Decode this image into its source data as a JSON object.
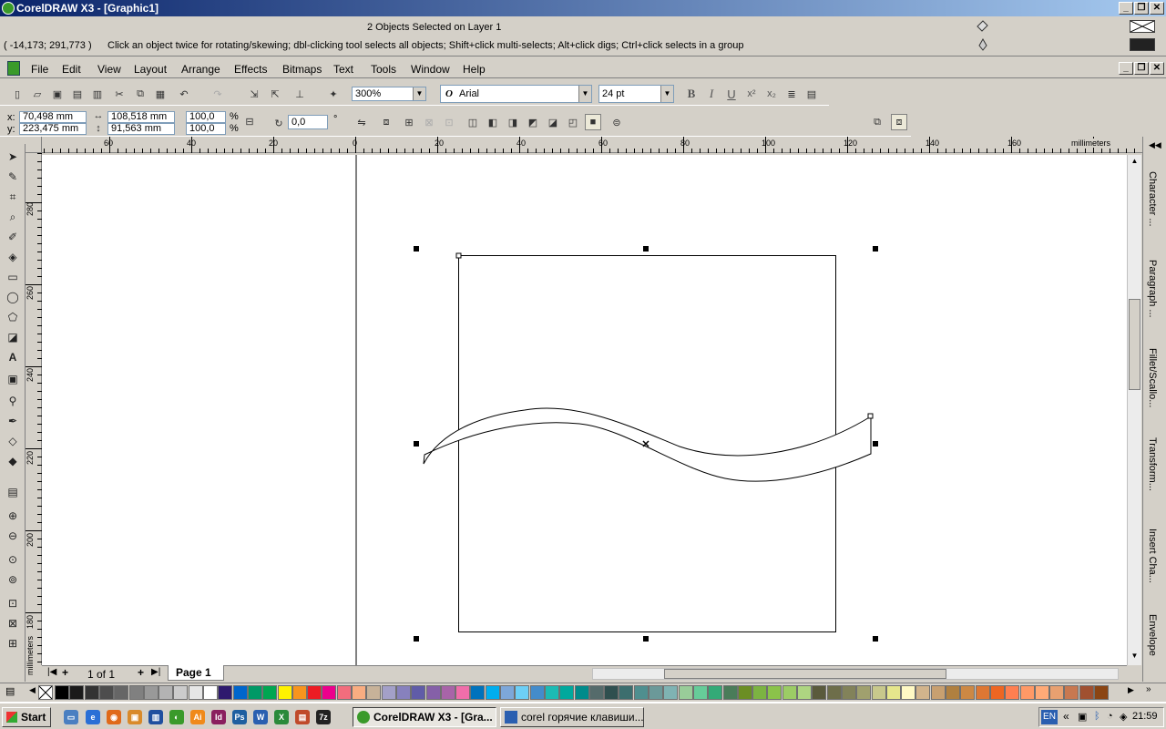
{
  "window": {
    "title": "CorelDRAW X3 - [Graphic1]"
  },
  "status": {
    "selection": "2 Objects Selected on Layer 1",
    "coords": "( -14,173; 291,773 )",
    "hint": "Click an object twice for rotating/skewing; dbl-clicking tool selects all objects; Shift+click multi-selects; Alt+click digs; Ctrl+click selects in a group"
  },
  "menu": [
    "File",
    "Edit",
    "View",
    "Layout",
    "Arrange",
    "Effects",
    "Bitmaps",
    "Text",
    "Tools",
    "Window",
    "Help"
  ],
  "toolbar": {
    "zoom": "300%",
    "font": "Arial",
    "font_size": "24 pt"
  },
  "property": {
    "x_label": "x:",
    "y_label": "y:",
    "x": "70,498 mm",
    "y": "223,475 mm",
    "width": "108,518 mm",
    "height": "91,563 mm",
    "scale_x": "100,0",
    "scale_y": "100,0",
    "pct": "%",
    "angle": "0,0",
    "deg": "°"
  },
  "hruler": {
    "unit": "millimeters",
    "ticks": [
      "60",
      "40",
      "20",
      "0",
      "20",
      "40",
      "60",
      "80",
      "100",
      "120",
      "140",
      "160"
    ]
  },
  "vruler": {
    "unit": "millimeters",
    "ticks": [
      "280",
      "260",
      "240",
      "220",
      "200",
      "180"
    ]
  },
  "dockers": [
    "Character ...",
    "Paragraph ...",
    "Fillet/Scallo...",
    "Transform...",
    "Insert Cha...",
    "Envelope"
  ],
  "pages": {
    "count": "1 of 1",
    "current": "Page 1"
  },
  "palette": [
    "#000000",
    "#1a1a1a",
    "#333333",
    "#4d4d4d",
    "#666666",
    "#808080",
    "#999999",
    "#b3b3b3",
    "#cccccc",
    "#e6e6e6",
    "#ffffff",
    "#2e1a6e",
    "#0066cc",
    "#009966",
    "#00a651",
    "#fff200",
    "#f7941d",
    "#ed1c24",
    "#ec008c",
    "#f26d7d",
    "#f9ad81",
    "#c7b299",
    "#a3a0c8",
    "#8781bd",
    "#605ca8",
    "#8560a8",
    "#a864a8",
    "#f06eaa",
    "#0072bc",
    "#00aeef",
    "#7da7d9",
    "#6dcff6",
    "#448ccb",
    "#1cbbb4",
    "#00a99d",
    "#008b8b",
    "#556b6b",
    "#2f4f4f",
    "#3c6e6e",
    "#4f8f8f",
    "#6b9999",
    "#7fb3b3",
    "#99cc99",
    "#66cc99",
    "#33aa77",
    "#4a7c59",
    "#6b8e23",
    "#7cb342",
    "#8bc34a",
    "#9ccc65",
    "#aed581",
    "#5a5a3c",
    "#6e6e4a",
    "#82825a",
    "#a0a06e",
    "#c8c88c",
    "#e6e68c",
    "#fff9c4",
    "#d2b48c",
    "#c8a070",
    "#b08040",
    "#cc8844",
    "#dd7733",
    "#ee6622",
    "#ff7f50",
    "#ff9966",
    "#ffaa77",
    "#e8a070",
    "#c87850",
    "#a05030",
    "#8b4513"
  ],
  "taskbar": {
    "start": "Start",
    "tasks": [
      "CorelDRAW X3 - [Gra...",
      "corel горячие клавиши...."
    ],
    "lang": "EN",
    "time": "21:59"
  },
  "colors": {
    "titlebar_start": "#0a246a",
    "titlebar_end": "#a6caf0",
    "chrome": "#d4d0c8"
  }
}
